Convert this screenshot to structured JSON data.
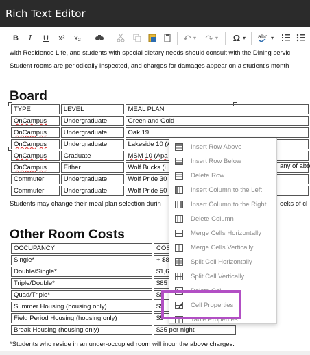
{
  "window": {
    "title": "Rich Text Editor"
  },
  "toolbar": {
    "bold": "B",
    "italic": "I",
    "underline": "U",
    "superscript": "x²",
    "subscript": "x₂",
    "special_char": "Ω",
    "dropdown_arrow": "▾"
  },
  "content": {
    "intro_line1": "with Residence Life, and students with special dietary needs should consult with the Dining servic",
    "intro_line2": "Student rooms are periodically inspected, and charges for damages appear on a student's month",
    "board_heading": "Board",
    "board_table": {
      "headers": [
        "TYPE",
        "LEVEL",
        "MEAL PLAN"
      ],
      "rows": [
        [
          "OnCampus",
          "Undergraduate",
          "Green and Gold"
        ],
        [
          "OnCampus",
          "Undergraduate",
          "Oak 19"
        ],
        [
          "OnCampus",
          "Undergraduate",
          "Lakeside 10 (A"
        ],
        [
          "OnCampus",
          "Graduate",
          "MSM 10 (Apa"
        ],
        [
          "OnCampus",
          "Either",
          "Wolf Bucks (i"
        ],
        [
          "Commuter",
          "Undergraduate",
          "Wolf Pride 30"
        ],
        [
          "Commuter",
          "Undergraduate",
          "Wolf Pride 50"
        ]
      ],
      "overflow_text": "any of abo"
    },
    "change_note": "Students may change their meal plan selection durin",
    "change_note_tail": "eeks of cl",
    "other_heading": "Other Room Costs",
    "other_table": {
      "headers": [
        "OCCUPANCY",
        "COS"
      ],
      "rows": [
        [
          "Single*",
          "+ $8"
        ],
        [
          "Double/Single*",
          "$1,6"
        ],
        [
          "Triple/Double*",
          "$85"
        ],
        [
          "Quad/Triple*",
          "$8"
        ],
        [
          "Summer Housing (housing only)",
          "$5"
        ],
        [
          "Field Period Housing (housing only)",
          "$5"
        ],
        [
          "Break Housing (housing only)",
          "$35 per night"
        ]
      ]
    },
    "footnote": "*Students who reside in an under-occupied room will incur the above charges."
  },
  "context_menu": {
    "items": [
      {
        "label": "Insert Row Above",
        "icon": "insert-row-above-icon"
      },
      {
        "label": "Insert Row Below",
        "icon": "insert-row-below-icon"
      },
      {
        "label": "Delete Row",
        "icon": "delete-row-icon"
      },
      {
        "label": "Insert Column to the Left",
        "icon": "insert-column-left-icon"
      },
      {
        "label": "Insert Column to the Right",
        "icon": "insert-column-right-icon"
      },
      {
        "label": "Delete Column",
        "icon": "delete-column-icon"
      },
      {
        "label": "Merge Cells Horizontally",
        "icon": "merge-horizontal-icon"
      },
      {
        "label": "Merge Cells Vertically",
        "icon": "merge-vertical-icon"
      },
      {
        "label": "Split Cell Horizontally",
        "icon": "split-horizontal-icon"
      },
      {
        "label": "Split Cell Vertically",
        "icon": "split-vertical-icon"
      },
      {
        "label": "Delete Cell",
        "icon": "delete-cell-icon"
      },
      {
        "label": "Cell Properties",
        "icon": "cell-properties-icon"
      },
      {
        "label": "Table Properties",
        "icon": "table-properties-icon"
      }
    ]
  },
  "colors": {
    "titlebar": "#2b2b2b",
    "highlight": "#b24fc4",
    "menu_text": "#8a8a8a"
  }
}
